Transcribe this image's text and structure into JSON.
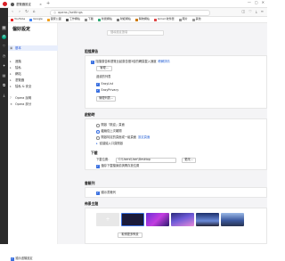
{
  "tab": {
    "title": "瀏覽器設定",
    "close_label": "×"
  },
  "newtab_label": "+",
  "window_controls": [
    "—",
    "▢",
    "✕"
  ],
  "address": {
    "url": "opera://settings"
  },
  "bookmarks": [
    {
      "label": "YouTube",
      "color": "#e22"
    },
    {
      "label": "Google",
      "color": "#4285f4"
    },
    {
      "label": "國家公園",
      "color": "#f0a020"
    },
    {
      "label": "工作網站",
      "color": "#555"
    },
    {
      "label": "下載",
      "color": "#888"
    },
    {
      "label": "新聞網站",
      "color": "#3a7"
    },
    {
      "label": "財經網站",
      "color": "#777"
    },
    {
      "label": "購物網站",
      "color": "#c70"
    },
    {
      "label": "Gmail 收件匣",
      "color": "#d44"
    },
    {
      "label": "圖片",
      "color": "#999"
    },
    {
      "label": "其他",
      "color": "#999"
    }
  ],
  "nav": {
    "title": "偏好設定",
    "items": [
      "基本",
      "進階",
      "隱私",
      "網站",
      "瀏覽器",
      "隱私 & 安全",
      "Opera 說明",
      "Opera 評分"
    ],
    "advanced_label": "顯示進階設定"
  },
  "search": {
    "placeholder": "搜尋設定選項"
  },
  "adblock": {
    "title": "阻擋廣告",
    "enable_label": "阻擋廣告和瀏覽比起廣告慢3倍的網頁載入速度",
    "learn_more": "瞭解詳情",
    "manage_button": "管理...",
    "lists_heading": "過濾的列表",
    "list1": "EasyList",
    "list2": "EasyPrivacy",
    "manage_lists_button": "管理列表..."
  },
  "startup": {
    "title": "啟動時",
    "opt1": "開啟「歡迎」頁面",
    "opt2": "繼續從上次離開",
    "opt3": "開啟特定的頁面或一組頁面",
    "opt3_link": "設定頁面",
    "opt4": "從建議入口頁開啟"
  },
  "downloads": {
    "title": "下載",
    "location_label": "下載位置：",
    "path": "C:\\Users\\User\\Desktop",
    "change_button": "更改...",
    "ask_label": "儲存下載檔案前詢問存放位置"
  },
  "bookmarks_bar": {
    "title": "書籤列",
    "show_label": "顯示書籤列"
  },
  "themes": {
    "title": "佈景主題",
    "add_label": "+",
    "get_more_button": "取得更多佈景"
  }
}
